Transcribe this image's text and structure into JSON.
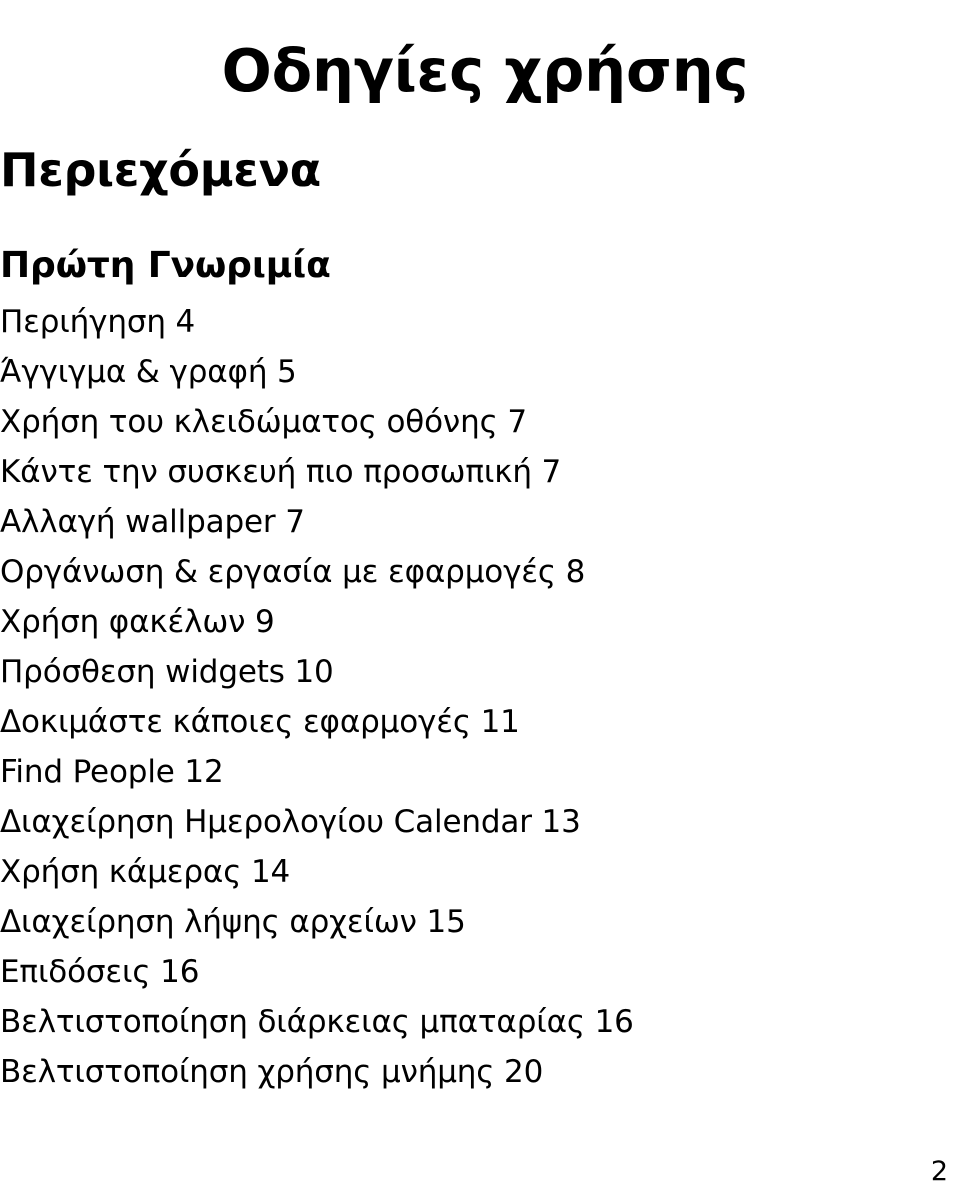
{
  "document": {
    "title": "Οδηγίες χρήσης",
    "page_number": "2",
    "background_color": "#ffffff",
    "text_color": "#000000"
  },
  "toc": {
    "heading": "Περιεχόμενα",
    "subheading": "Πρώτη Γνωριμία",
    "entries": [
      {
        "label": "Περιήγηση",
        "page": "4",
        "text": "Περιήγηση 4"
      },
      {
        "label": "Άγγιγμα & γραφή",
        "page": "5",
        "text": "Άγγιγμα & γραφή 5"
      },
      {
        "label": "Χρήση του κλειδώματος οθόνης",
        "page": "7",
        "text": "Χρήση του κλειδώματος οθόνης 7"
      },
      {
        "label": "Κάντε την συσκευή πιο προσωπική",
        "page": "7",
        "text": "Κάντε την συσκευή πιο προσωπική 7"
      },
      {
        "label": "Αλλαγή wallpaper",
        "page": "7",
        "text": "Αλλαγή wallpaper 7"
      },
      {
        "label": "Οργάνωση & εργασία με εφαρμογές",
        "page": "8",
        "text": "Οργάνωση & εργασία με εφαρμογές 8"
      },
      {
        "label": "Χρήση φακέλων",
        "page": "9",
        "text": "Χρήση φακέλων 9"
      },
      {
        "label": "Πρόσθεση widgets",
        "page": "10",
        "text": "Πρόσθεση widgets 10"
      },
      {
        "label": "Δοκιμάστε κάποιες εφαρμογές",
        "page": "11",
        "text": "Δοκιμάστε κάποιες εφαρμογές 11"
      },
      {
        "label": "Find People",
        "page": "12",
        "text": "Find People 12"
      },
      {
        "label": "Διαχείρηση Ημερολογίου Calendar",
        "page": "13",
        "text": "Διαχείρηση Ημερολογίου Calendar 13"
      },
      {
        "label": "Χρήση κάμερας",
        "page": "14",
        "text": "Χρήση κάμερας 14"
      },
      {
        "label": "Διαχείρηση λήψης αρχείων",
        "page": "15",
        "text": "Διαχείρηση λήψης αρχείων 15"
      },
      {
        "label": "Επιδόσεις",
        "page": "16",
        "text": "Επιδόσεις 16"
      },
      {
        "label": "Βελτιστοποίηση διάρκειας μπαταρίας",
        "page": "16",
        "text": "Βελτιστοποίηση διάρκειας μπαταρίας 16"
      },
      {
        "label": "Βελτιστοποίηση χρήσης μνήμης",
        "page": "20",
        "text": "Βελτιστοποίηση χρήσης μνήμης 20"
      }
    ]
  }
}
